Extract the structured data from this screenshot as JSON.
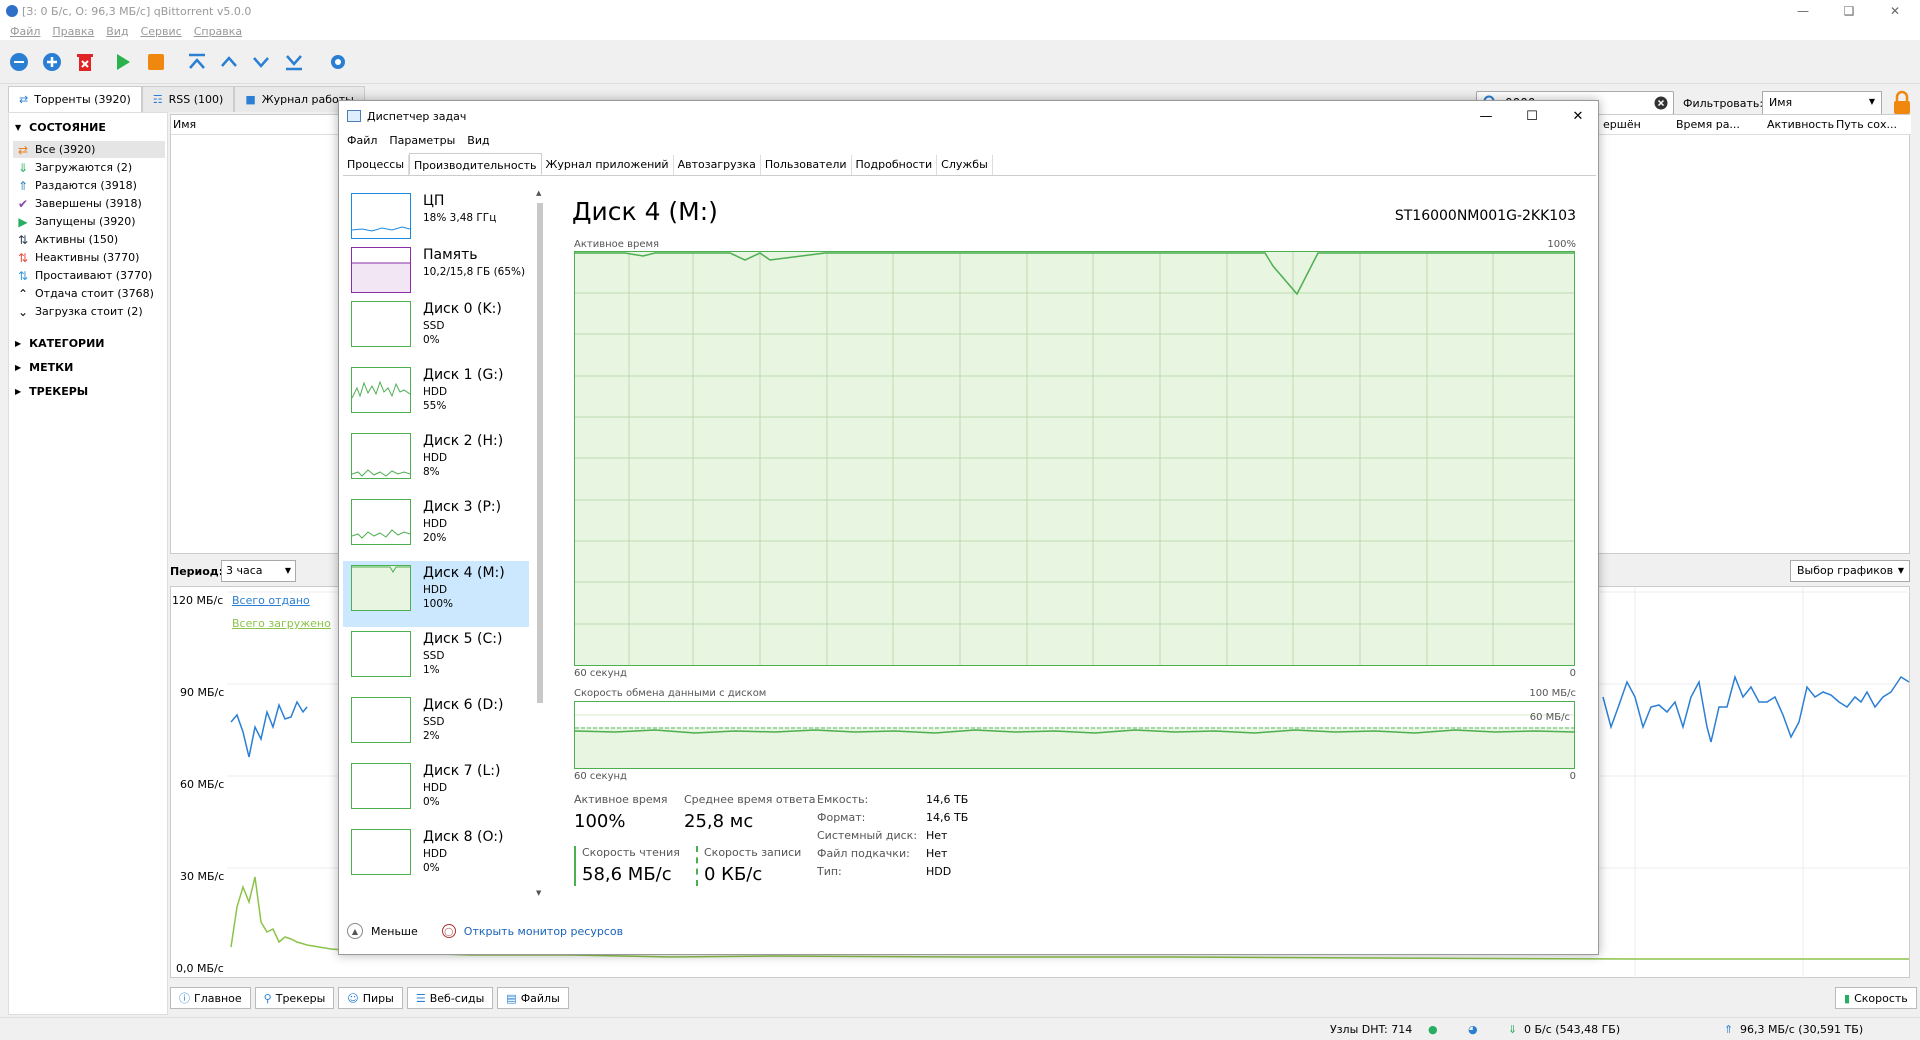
{
  "qbt": {
    "title": "[З: 0 Б/с, О: 96,3 МБ/с] qBittorrent v5.0.0",
    "menu": [
      "Файл",
      "Правка",
      "Вид",
      "Сервис",
      "Справка"
    ],
    "search_value": "0000",
    "filter_label": "Фильтровать:",
    "filter_value": "Имя",
    "tabs": [
      {
        "label": "Торренты (3920)"
      },
      {
        "label": "RSS (100)"
      },
      {
        "label": "Журнал работы"
      }
    ],
    "sidebar": {
      "status_header": "СОСТОЯНИЕ",
      "items": [
        {
          "label": "Все (3920)",
          "icon": "shuffle-icon",
          "color": "#e67e22"
        },
        {
          "label": "Загружаются (2)",
          "icon": "download-icon",
          "color": "#27ae60"
        },
        {
          "label": "Раздаются (3918)",
          "icon": "upload-icon",
          "color": "#2980b9"
        },
        {
          "label": "Завершены (3918)",
          "icon": "check-icon",
          "color": "#8e44ad"
        },
        {
          "label": "Запущены (3920)",
          "icon": "play-icon",
          "color": "#27ae60"
        },
        {
          "label": "Активны (150)",
          "icon": "updown-icon",
          "color": "#2c3e50"
        },
        {
          "label": "Неактивны (3770)",
          "icon": "updown-red-icon",
          "color": "#e74c3c"
        },
        {
          "label": "Простаивают (3770)",
          "icon": "updown-blue-icon",
          "color": "#3498db"
        },
        {
          "label": "Отдача стоит (3768)",
          "icon": "stalled-up-icon",
          "color": "#000"
        },
        {
          "label": "Загрузка стоит (2)",
          "icon": "stalled-down-icon",
          "color": "#000"
        }
      ],
      "categories": "КАТЕГОРИИ",
      "tags": "МЕТКИ",
      "trackers": "ТРЕКЕРЫ"
    },
    "columns": {
      "name": "Имя",
      "completed": "ершён",
      "time": "Время ра...",
      "activity": "Активность",
      "path": "Путь сох..."
    },
    "period_label": "Период:",
    "period_value": "3 часа",
    "graph_select": "Выбор графиков",
    "y_labels": [
      "120 МБ/с",
      "90 МБ/с",
      "60 МБ/с",
      "30 МБ/с",
      "0,0 МБ/с"
    ],
    "legend_up": "Всего отдано",
    "legend_down": "Всего загружено",
    "bottom_tabs": [
      "Главное",
      "Трекеры",
      "Пиры",
      "Веб-сиды",
      "Файлы"
    ],
    "speed_tab": "Скорость",
    "status": {
      "dht": "Узлы DHT: 714",
      "down": "0 Б/с (543,48 ГБ)",
      "up": "96,3 МБ/с (30,591 ТБ)"
    }
  },
  "tm": {
    "title": "Диспетчер задач",
    "menu": [
      "Файл",
      "Параметры",
      "Вид"
    ],
    "tabs": [
      "Процессы",
      "Производительность",
      "Журнал приложений",
      "Автозагрузка",
      "Пользователи",
      "Подробности",
      "Службы"
    ],
    "devices": [
      {
        "name": "ЦП",
        "l1": "18%  3,48 ГГц",
        "l2": "",
        "color": "#1a8ae0"
      },
      {
        "name": "Память",
        "l1": "10,2/15,8 ГБ (65%)",
        "l2": "",
        "color": "#8b2ea6"
      },
      {
        "name": "Диск 0 (K:)",
        "l1": "SSD",
        "l2": "0%",
        "color": "#4caf50"
      },
      {
        "name": "Диск 1 (G:)",
        "l1": "HDD",
        "l2": "55%",
        "color": "#4caf50"
      },
      {
        "name": "Диск 2 (H:)",
        "l1": "HDD",
        "l2": "8%",
        "color": "#4caf50"
      },
      {
        "name": "Диск 3 (P:)",
        "l1": "HDD",
        "l2": "20%",
        "color": "#4caf50"
      },
      {
        "name": "Диск 4 (M:)",
        "l1": "HDD",
        "l2": "100%",
        "color": "#4caf50"
      },
      {
        "name": "Диск 5 (C:)",
        "l1": "SSD",
        "l2": "1%",
        "color": "#4caf50"
      },
      {
        "name": "Диск 6 (D:)",
        "l1": "SSD",
        "l2": "2%",
        "color": "#4caf50"
      },
      {
        "name": "Диск 7 (L:)",
        "l1": "HDD",
        "l2": "0%",
        "color": "#4caf50"
      },
      {
        "name": "Диск 8 (O:)",
        "l1": "HDD",
        "l2": "0%",
        "color": "#4caf50"
      }
    ],
    "disk_title": "Диск 4 (M:)",
    "model": "ST16000NM001G-2KK103",
    "g1_label": "Активное время",
    "g1_max": "100%",
    "g1_left": "60 секунд",
    "g1_right": "0",
    "g2_label": "Скорость обмена данными с диском",
    "g2_max": "100 МБ/с",
    "g2_mid": "60 МБ/с",
    "g2_left": "60 секунд",
    "g2_right": "0",
    "stats": {
      "active_label": "Активное время",
      "active_value": "100%",
      "resp_label": "Среднее время ответа",
      "resp_value": "25,8 мс",
      "read_label": "Скорость чтения",
      "read_value": "58,6 МБ/с",
      "write_label": "Скорость записи",
      "write_value": "0 КБ/с"
    },
    "props": [
      {
        "k": "Емкость:",
        "v": "14,6 ТБ"
      },
      {
        "k": "Формат:",
        "v": "14,6 ТБ"
      },
      {
        "k": "Системный диск:",
        "v": "Нет"
      },
      {
        "k": "Файл подкачки:",
        "v": "Нет"
      },
      {
        "k": "Тип:",
        "v": "HDD"
      }
    ],
    "less": "Меньше",
    "monitor": "Открыть монитор ресурсов"
  }
}
